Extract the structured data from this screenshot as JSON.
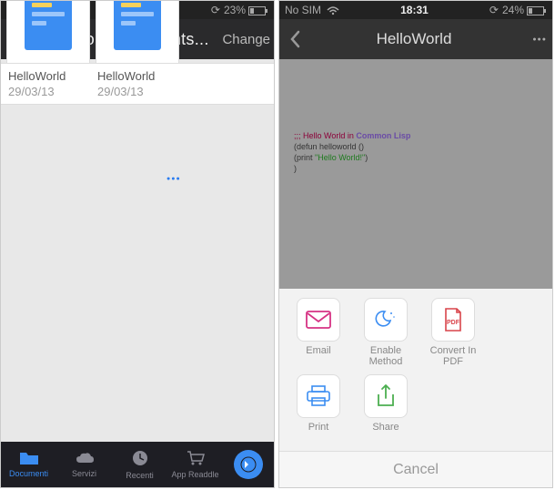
{
  "status": {
    "carrier": "No SIM",
    "time": "18:31",
    "battery_left": "23%",
    "battery_right": "24%"
  },
  "left": {
    "header": {
      "title": "Hello Worl Documents...",
      "action": "Change"
    },
    "files": [
      {
        "name": "HelloWorld",
        "date": "29/03/13"
      },
      {
        "name": "HelloWorld",
        "date": "29/03/13"
      }
    ],
    "tabs": [
      {
        "id": "documents",
        "label": "Documenti"
      },
      {
        "id": "services",
        "label": "Servizi"
      },
      {
        "id": "recents",
        "label": "Recenti"
      },
      {
        "id": "readdle",
        "label": "App Readdle"
      }
    ]
  },
  "right": {
    "header": {
      "title": "HelloWorld"
    },
    "code": {
      "comment_prefix": ";;; Hello World in",
      "lang": " Common Lisp",
      "line2a": "(defun",
      "line2b": " helloworld ()",
      "line3a": "  (print ",
      "line3b": "\"Hello World!\"",
      "line3c": ")",
      "line4": ")"
    },
    "actions": [
      {
        "id": "email",
        "label": "Email"
      },
      {
        "id": "enable",
        "label": "Enable Method"
      },
      {
        "id": "pdf",
        "label": "Convert In PDF"
      },
      {
        "id": "print",
        "label": "Print"
      },
      {
        "id": "share",
        "label": "Share"
      }
    ],
    "cancel": "Cancel"
  },
  "glyphs": {
    "wifi": "ᯤ",
    "refresh": "⟳",
    "more": "●●●",
    "back": "‹"
  }
}
